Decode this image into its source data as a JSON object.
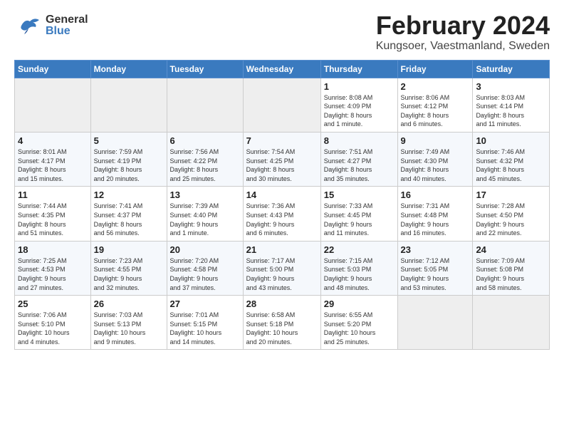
{
  "header": {
    "logo_general": "General",
    "logo_blue": "Blue",
    "month_title": "February 2024",
    "subtitle": "Kungsoer, Vaestmanland, Sweden"
  },
  "weekdays": [
    "Sunday",
    "Monday",
    "Tuesday",
    "Wednesday",
    "Thursday",
    "Friday",
    "Saturday"
  ],
  "weeks": [
    [
      {
        "day": "",
        "info": ""
      },
      {
        "day": "",
        "info": ""
      },
      {
        "day": "",
        "info": ""
      },
      {
        "day": "",
        "info": ""
      },
      {
        "day": "1",
        "info": "Sunrise: 8:08 AM\nSunset: 4:09 PM\nDaylight: 8 hours\nand 1 minute."
      },
      {
        "day": "2",
        "info": "Sunrise: 8:06 AM\nSunset: 4:12 PM\nDaylight: 8 hours\nand 6 minutes."
      },
      {
        "day": "3",
        "info": "Sunrise: 8:03 AM\nSunset: 4:14 PM\nDaylight: 8 hours\nand 11 minutes."
      }
    ],
    [
      {
        "day": "4",
        "info": "Sunrise: 8:01 AM\nSunset: 4:17 PM\nDaylight: 8 hours\nand 15 minutes."
      },
      {
        "day": "5",
        "info": "Sunrise: 7:59 AM\nSunset: 4:19 PM\nDaylight: 8 hours\nand 20 minutes."
      },
      {
        "day": "6",
        "info": "Sunrise: 7:56 AM\nSunset: 4:22 PM\nDaylight: 8 hours\nand 25 minutes."
      },
      {
        "day": "7",
        "info": "Sunrise: 7:54 AM\nSunset: 4:25 PM\nDaylight: 8 hours\nand 30 minutes."
      },
      {
        "day": "8",
        "info": "Sunrise: 7:51 AM\nSunset: 4:27 PM\nDaylight: 8 hours\nand 35 minutes."
      },
      {
        "day": "9",
        "info": "Sunrise: 7:49 AM\nSunset: 4:30 PM\nDaylight: 8 hours\nand 40 minutes."
      },
      {
        "day": "10",
        "info": "Sunrise: 7:46 AM\nSunset: 4:32 PM\nDaylight: 8 hours\nand 45 minutes."
      }
    ],
    [
      {
        "day": "11",
        "info": "Sunrise: 7:44 AM\nSunset: 4:35 PM\nDaylight: 8 hours\nand 51 minutes."
      },
      {
        "day": "12",
        "info": "Sunrise: 7:41 AM\nSunset: 4:37 PM\nDaylight: 8 hours\nand 56 minutes."
      },
      {
        "day": "13",
        "info": "Sunrise: 7:39 AM\nSunset: 4:40 PM\nDaylight: 9 hours\nand 1 minute."
      },
      {
        "day": "14",
        "info": "Sunrise: 7:36 AM\nSunset: 4:43 PM\nDaylight: 9 hours\nand 6 minutes."
      },
      {
        "day": "15",
        "info": "Sunrise: 7:33 AM\nSunset: 4:45 PM\nDaylight: 9 hours\nand 11 minutes."
      },
      {
        "day": "16",
        "info": "Sunrise: 7:31 AM\nSunset: 4:48 PM\nDaylight: 9 hours\nand 16 minutes."
      },
      {
        "day": "17",
        "info": "Sunrise: 7:28 AM\nSunset: 4:50 PM\nDaylight: 9 hours\nand 22 minutes."
      }
    ],
    [
      {
        "day": "18",
        "info": "Sunrise: 7:25 AM\nSunset: 4:53 PM\nDaylight: 9 hours\nand 27 minutes."
      },
      {
        "day": "19",
        "info": "Sunrise: 7:23 AM\nSunset: 4:55 PM\nDaylight: 9 hours\nand 32 minutes."
      },
      {
        "day": "20",
        "info": "Sunrise: 7:20 AM\nSunset: 4:58 PM\nDaylight: 9 hours\nand 37 minutes."
      },
      {
        "day": "21",
        "info": "Sunrise: 7:17 AM\nSunset: 5:00 PM\nDaylight: 9 hours\nand 43 minutes."
      },
      {
        "day": "22",
        "info": "Sunrise: 7:15 AM\nSunset: 5:03 PM\nDaylight: 9 hours\nand 48 minutes."
      },
      {
        "day": "23",
        "info": "Sunrise: 7:12 AM\nSunset: 5:05 PM\nDaylight: 9 hours\nand 53 minutes."
      },
      {
        "day": "24",
        "info": "Sunrise: 7:09 AM\nSunset: 5:08 PM\nDaylight: 9 hours\nand 58 minutes."
      }
    ],
    [
      {
        "day": "25",
        "info": "Sunrise: 7:06 AM\nSunset: 5:10 PM\nDaylight: 10 hours\nand 4 minutes."
      },
      {
        "day": "26",
        "info": "Sunrise: 7:03 AM\nSunset: 5:13 PM\nDaylight: 10 hours\nand 9 minutes."
      },
      {
        "day": "27",
        "info": "Sunrise: 7:01 AM\nSunset: 5:15 PM\nDaylight: 10 hours\nand 14 minutes."
      },
      {
        "day": "28",
        "info": "Sunrise: 6:58 AM\nSunset: 5:18 PM\nDaylight: 10 hours\nand 20 minutes."
      },
      {
        "day": "29",
        "info": "Sunrise: 6:55 AM\nSunset: 5:20 PM\nDaylight: 10 hours\nand 25 minutes."
      },
      {
        "day": "",
        "info": ""
      },
      {
        "day": "",
        "info": ""
      }
    ]
  ]
}
